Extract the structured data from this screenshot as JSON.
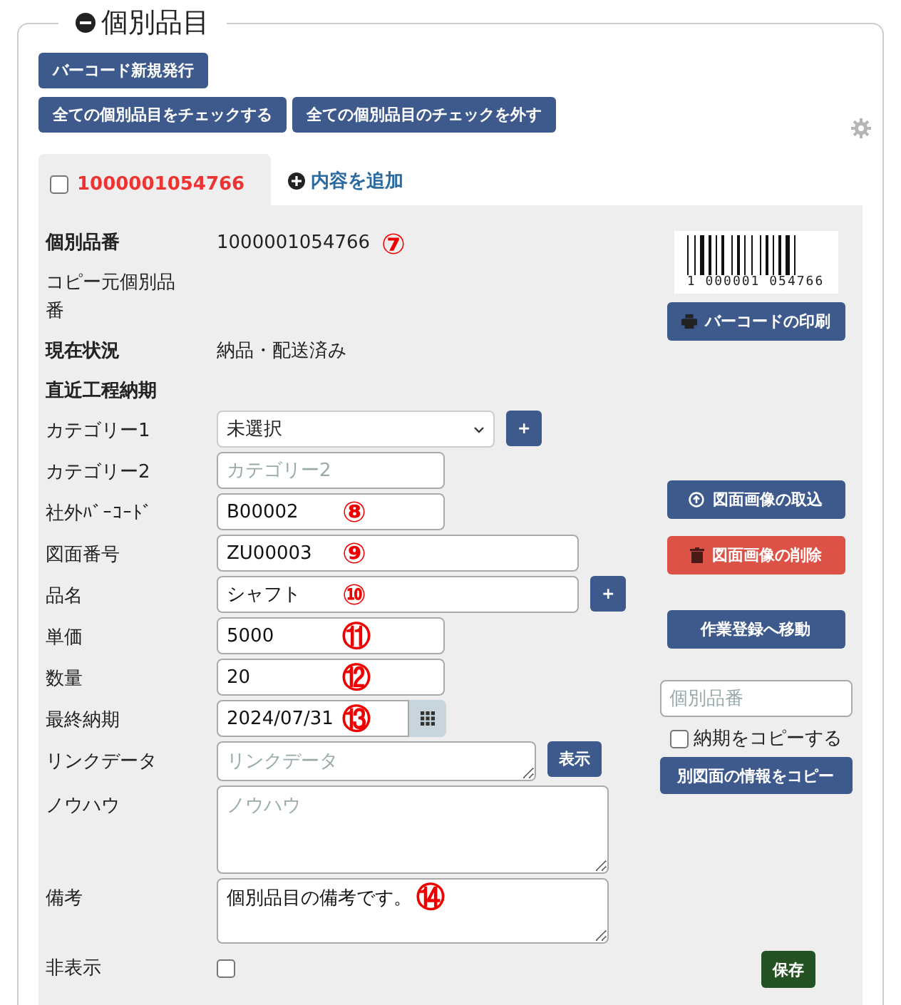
{
  "section": {
    "title": "個別品目",
    "expanded": true
  },
  "toolbar": [
    {
      "label": "バーコード新規発行"
    },
    {
      "label": "全ての個別品目をチェックする"
    },
    {
      "label": "全ての個別品目のチェックを外す"
    }
  ],
  "tabs": [
    {
      "label": "1000001054766",
      "checked": false,
      "selected": true
    }
  ],
  "add_content": {
    "label": "内容を追加"
  },
  "fields": [
    {
      "kind": "info",
      "label": "個別品番",
      "value": "1000001054766",
      "marker": "⑦"
    },
    {
      "kind": "static",
      "label": "コピー元個別品番"
    },
    {
      "kind": "info",
      "label": "現在状況",
      "value": "納品・配送済み"
    },
    {
      "kind": "info",
      "label": "直近工程納期"
    },
    {
      "kind": "select",
      "label": "カテゴリー1",
      "value": "未選択",
      "button": "+"
    },
    {
      "kind": "input",
      "label": "カテゴリー2",
      "placeholder": "カテゴリー2"
    },
    {
      "kind": "input",
      "label": "社外ﾊﾞｰｺｰﾄﾞ",
      "value": "B00002",
      "marker": "⑧"
    },
    {
      "kind": "wide-input",
      "label": "図面番号",
      "value": "ZU00003",
      "marker": "⑨"
    },
    {
      "kind": "wide-input",
      "label": "品名",
      "value": "シャフト",
      "marker": "⑩",
      "button": "+"
    },
    {
      "kind": "input",
      "label": "単価",
      "value": "5000",
      "marker": "⑪"
    },
    {
      "kind": "input",
      "label": "数量",
      "value": "20",
      "marker": "⑫"
    },
    {
      "kind": "date",
      "label": "最終納期",
      "value": "2024/07/31",
      "marker": "⑬"
    },
    {
      "kind": "line-textarea",
      "label": "リンクデータ",
      "placeholder": "リンクデータ",
      "button": "表示"
    },
    {
      "kind": "tall-textarea",
      "label": "ノウハウ",
      "placeholder": "ノウハウ"
    },
    {
      "kind": "textarea",
      "label": "備考",
      "value": "個別品目の備考です。",
      "marker": "⑭"
    },
    {
      "kind": "checkbox",
      "label": "非表示",
      "checked": false
    }
  ],
  "sidebar": {
    "barcode_text": "1 000001 054766",
    "print_button": "バーコードの印刷",
    "import_button": "図面画像の取込",
    "delete_button": "図面画像の削除",
    "work_button": "作業登録へ移動",
    "copy_field": {
      "placeholder": "個別品番"
    },
    "copy_due": {
      "label": "納期をコピーする",
      "checked": false
    },
    "copy_button": "別図面の情報をコピー",
    "save_button": "保存"
  }
}
